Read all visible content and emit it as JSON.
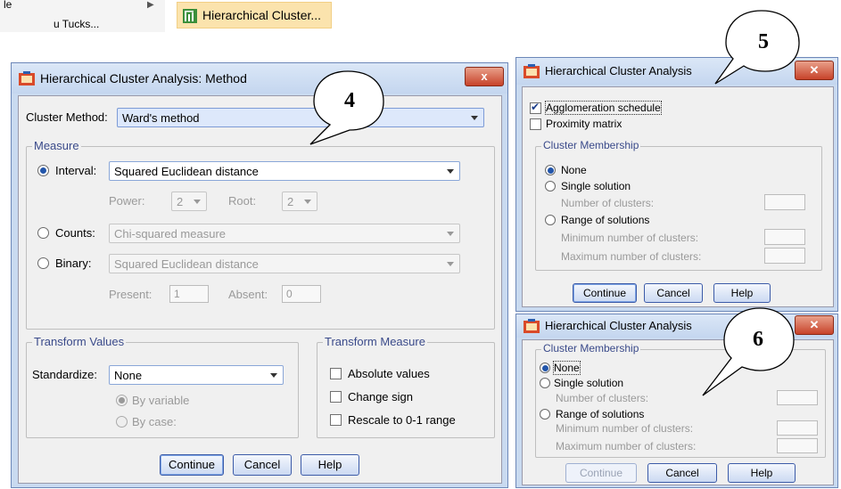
{
  "menu": {
    "left_item": "le",
    "left_item2": "u  Tucks...",
    "highlight_item": "Hierarchical Cluster..."
  },
  "method_dialog": {
    "title": "Hierarchical Cluster Analysis: Method",
    "close": "x",
    "cluster_method_label": "Cluster Method:",
    "cluster_method_value": "Ward's method",
    "measure_legend": "Measure",
    "interval_label": "Interval:",
    "interval_value": "Squared Euclidean distance",
    "power_label": "Power:",
    "power_value": "2",
    "root_label": "Root:",
    "root_value": "2",
    "counts_label": "Counts:",
    "counts_value": "Chi-squared measure",
    "binary_label": "Binary:",
    "binary_value": "Squared Euclidean distance",
    "present_label": "Present:",
    "present_value": "1",
    "absent_label": "Absent:",
    "absent_value": "0",
    "transform_values_legend": "Transform Values",
    "standardize_label": "Standardize:",
    "standardize_value": "None",
    "by_variable": "By variable",
    "by_case": "By case:",
    "transform_measure_legend": "Transform Measure",
    "absolute_values": "Absolute values",
    "change_sign": "Change sign",
    "rescale": "Rescale to 0-1 range",
    "continue": "Continue",
    "cancel": "Cancel",
    "help": "Help"
  },
  "stats_dialog": {
    "title": "Hierarchical Cluster Analysis",
    "agglomeration_schedule": "Agglomeration schedule",
    "proximity_matrix": "Proximity matrix",
    "cluster_membership_legend": "Cluster Membership",
    "none": "None",
    "single_solution": "Single solution",
    "number_of_clusters": "Number of clusters:",
    "range_of_solutions": "Range of solutions",
    "minimum": "Minimum number of clusters:",
    "maximum": "Maximum number of clusters:",
    "continue": "Continue",
    "cancel": "Cancel",
    "help": "Help"
  },
  "save_dialog": {
    "title": "Hierarchical Cluster Analysis",
    "cluster_membership_legend": "Cluster Membership",
    "none": "None",
    "single_solution": "Single solution",
    "number_of_clusters": "Number of clusters:",
    "range_of_solutions": "Range of solutions",
    "minimum": "Minimum number of clusters:",
    "maximum": "Maximum number of clusters:",
    "continue": "Continue",
    "cancel": "Cancel",
    "help": "Help"
  },
  "callouts": {
    "four": "4",
    "five": "5",
    "six": "6"
  },
  "colors": {
    "title_bg": "#c9daf0",
    "close_red": "#c7432a",
    "legend_blue": "#3a4a8a",
    "menu_highlight": "#fbe3ad"
  }
}
